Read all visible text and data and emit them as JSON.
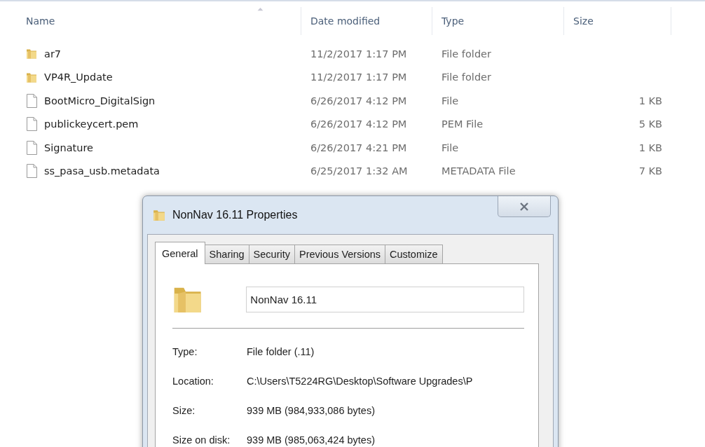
{
  "file_list": {
    "columns": [
      "Name",
      "Date modified",
      "Type",
      "Size"
    ],
    "rows": [
      {
        "kind": "folder",
        "name": "ar7",
        "date": "11/2/2017 1:17 PM",
        "type": "File folder"
      },
      {
        "kind": "folder",
        "name": "VP4R_Update",
        "date": "11/2/2017 1:17 PM",
        "type": "File folder"
      },
      {
        "kind": "file",
        "name": "BootMicro_DigitalSign",
        "date": "6/26/2017 4:12 PM",
        "type": "File",
        "size": "1 KB"
      },
      {
        "kind": "file",
        "name": "publickeycert.pem",
        "date": "6/26/2017 4:12 PM",
        "type": "PEM File",
        "size": "5 KB"
      },
      {
        "kind": "file",
        "name": "Signature",
        "date": "6/26/2017 4:21 PM",
        "type": "File",
        "size": "1 KB"
      },
      {
        "kind": "file",
        "name": "ss_pasa_usb.metadata",
        "date": "6/25/2017 1:32 AM",
        "type": "METADATA File",
        "size": "7 KB"
      }
    ]
  },
  "dialog": {
    "title": "NonNav 16.11 Properties",
    "tabs": [
      {
        "label": "General",
        "selected": true
      },
      {
        "label": "Sharing",
        "selected": false
      },
      {
        "label": "Security",
        "selected": false
      },
      {
        "label": "Previous Versions",
        "selected": false
      },
      {
        "label": "Customize",
        "selected": false
      }
    ],
    "name_value": "NonNav 16.11",
    "properties": [
      {
        "label": "Type:",
        "value": "File folder (.11)"
      },
      {
        "label": "Location:",
        "value": "C:\\Users\\T5224RG\\Desktop\\Software Upgrades\\P"
      },
      {
        "label": "Size:",
        "value": "939 MB (984,933,086 bytes)"
      },
      {
        "label": "Size on disk:",
        "value": "939 MB (985,063,424 bytes)"
      }
    ]
  }
}
